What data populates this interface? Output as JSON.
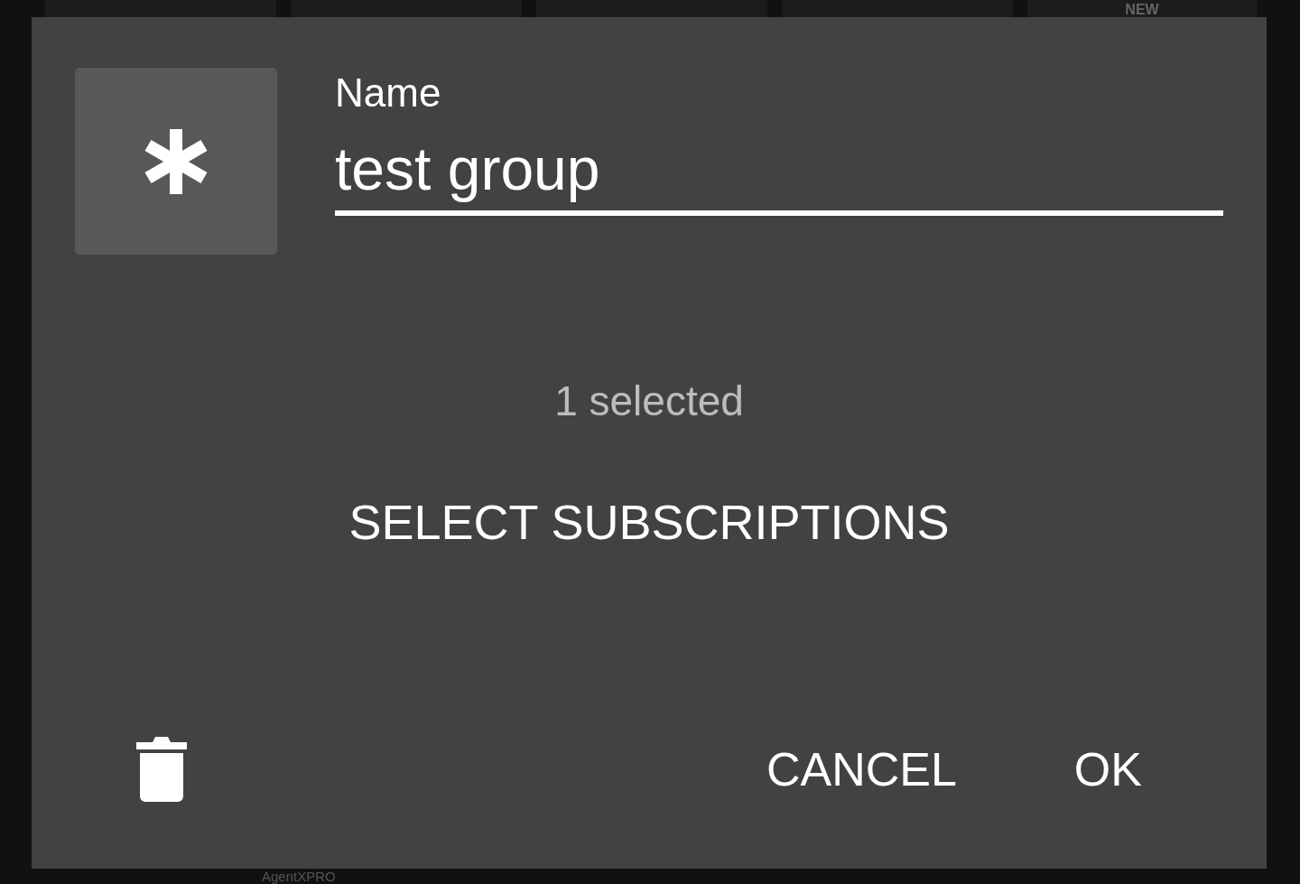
{
  "background": {
    "top_tile_label": "NEW",
    "bottom_label": "AgentXPRO"
  },
  "dialog": {
    "name_label": "Name",
    "name_value": "test group",
    "selection_count": "1 selected",
    "select_button": "SELECT SUBSCRIPTIONS",
    "buttons": [
      {
        "label": "CANCEL"
      },
      {
        "label": "OK"
      }
    ]
  }
}
